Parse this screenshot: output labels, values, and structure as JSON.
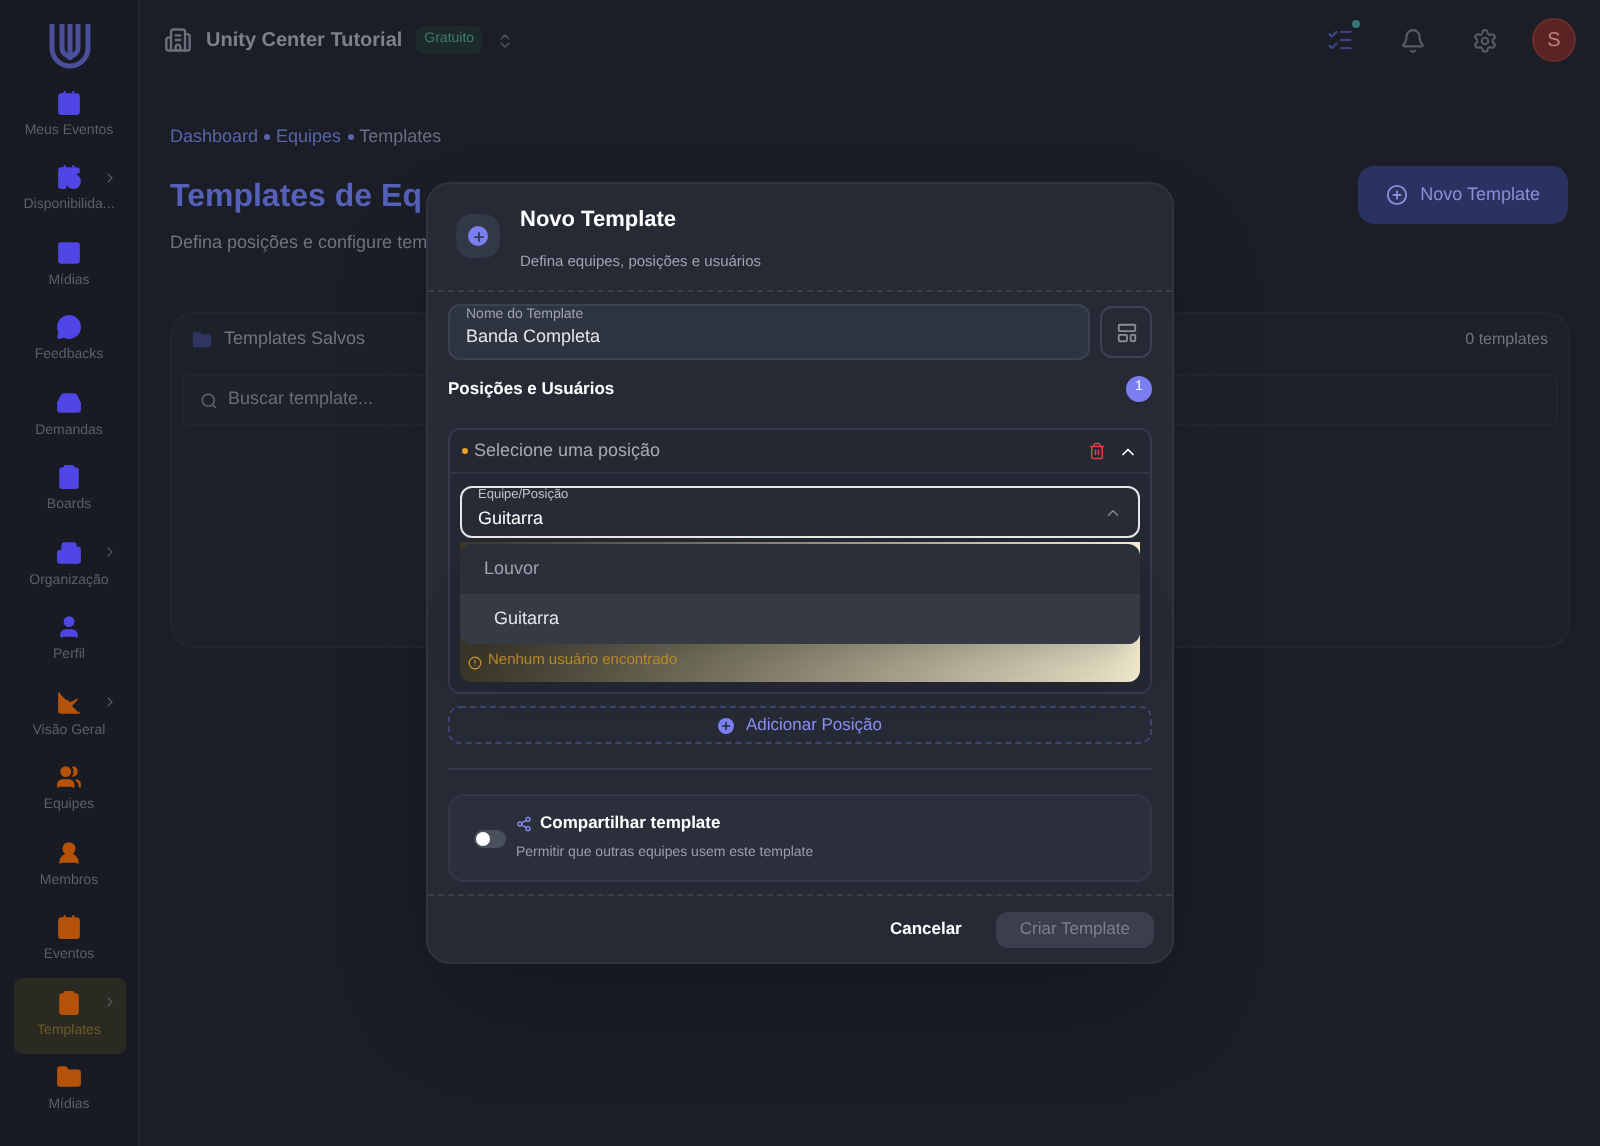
{
  "sidebar": {
    "items": [
      {
        "label": "Meus Eventos",
        "color": "#4f46e5",
        "has_submenu": false,
        "selected": false
      },
      {
        "label": "Disponibilida...",
        "color": "#4f46e5",
        "has_submenu": true,
        "selected": false
      },
      {
        "label": "Mídias",
        "color": "#4f46e5",
        "has_submenu": false,
        "selected": false
      },
      {
        "label": "Feedbacks",
        "color": "#4f46e5",
        "has_submenu": false,
        "selected": false
      },
      {
        "label": "Demandas",
        "color": "#4f46e5",
        "has_submenu": false,
        "selected": false
      },
      {
        "label": "Boards",
        "color": "#4f46e5",
        "has_submenu": false,
        "selected": false
      },
      {
        "label": "Organização",
        "color": "#4f46e5",
        "has_submenu": true,
        "selected": false
      },
      {
        "label": "Perfil",
        "color": "#4f46e5",
        "has_submenu": false,
        "selected": false
      },
      {
        "label": "Visão Geral",
        "color": "#b45309",
        "has_submenu": true,
        "selected": false
      },
      {
        "label": "Equipes",
        "color": "#b45309",
        "has_submenu": false,
        "selected": false
      },
      {
        "label": "Membros",
        "color": "#b45309",
        "has_submenu": false,
        "selected": false
      },
      {
        "label": "Eventos",
        "color": "#b45309",
        "has_submenu": false,
        "selected": false
      },
      {
        "label": "Templates",
        "color": "#b45309",
        "has_submenu": true,
        "selected": true
      },
      {
        "label": "Mídias",
        "color": "#b45309",
        "has_submenu": false,
        "selected": false
      }
    ]
  },
  "topbar": {
    "organization": "Unity Center Tutorial",
    "plan_badge": "Gratuito",
    "avatar_initial": "S",
    "notification_dot": true
  },
  "page": {
    "breadcrumb": [
      "Dashboard",
      "Equipes",
      "Templates"
    ],
    "title": "Templates de Eq",
    "subtitle": "Defina posições e configure tem",
    "new_button": "Novo Template",
    "saved_card": {
      "title": "Templates Salvos",
      "count": "0 templates",
      "search_placeholder": "Buscar template..."
    }
  },
  "modal": {
    "title": "Novo Template",
    "subtitle": "Defina equipes, posições e usuários",
    "name_field": {
      "label": "Nome do Template",
      "value": "Banda Completa"
    },
    "positions_heading": "Posições e Usuários",
    "positions_count": "1",
    "position": {
      "header": "Selecione uma posição",
      "expanded": true,
      "select": {
        "label": "Equipe/Posição",
        "value": "Guitarra",
        "open": true,
        "options": [
          {
            "label": "Louvor",
            "selected": false
          },
          {
            "label": "Guitarra",
            "selected": true
          }
        ]
      },
      "warning": "Nenhum usuário encontrado"
    },
    "add_button": "Adicionar Posição",
    "share": {
      "title": "Compartilhar template",
      "description": "Permitir que outras equipes usem este template",
      "on": false
    },
    "cancel_button": "Cancelar",
    "create_button": "Criar Template",
    "create_disabled": true
  }
}
